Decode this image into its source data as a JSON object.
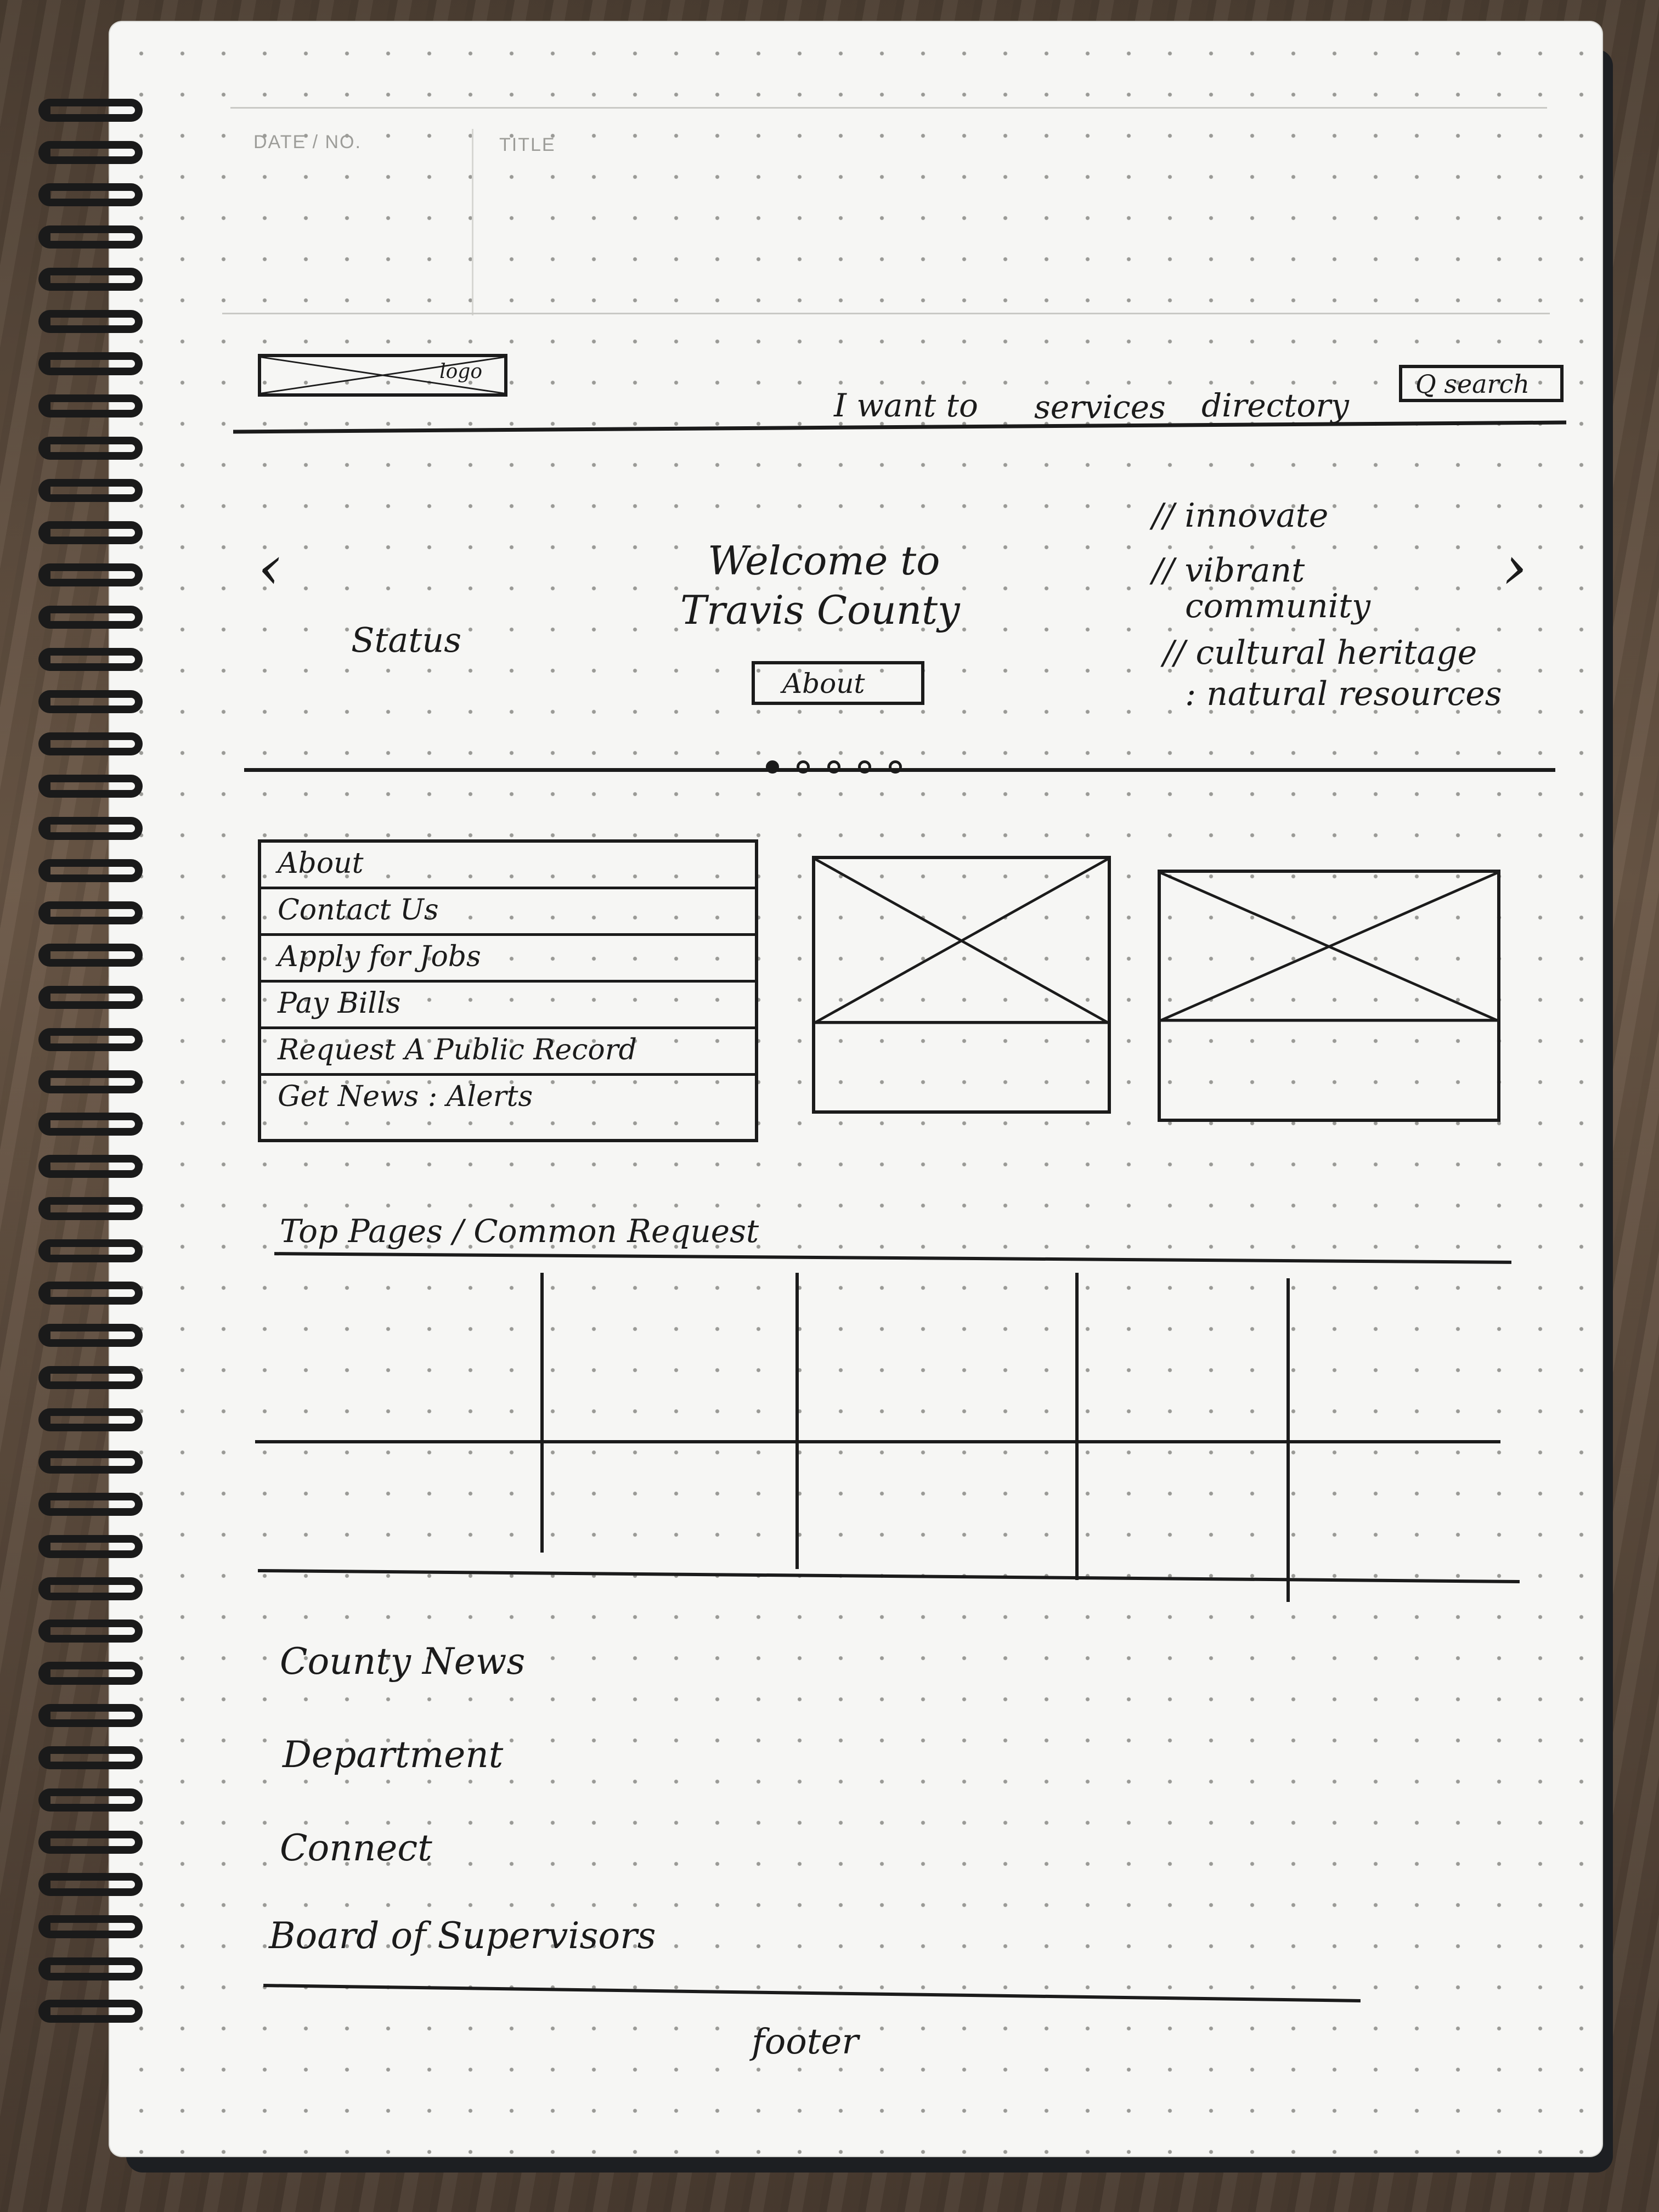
{
  "header_form": {
    "date_label": "DATE / NO.",
    "title_label": "TITLE"
  },
  "nav": {
    "logo": "logo",
    "items": [
      "I want to",
      "services",
      "directory"
    ],
    "search": "Q search"
  },
  "hero": {
    "prev": "‹",
    "next": "›",
    "status": "Status",
    "welcome_line1": "Welcome to",
    "welcome_line2": "Travis County",
    "about_button": "About",
    "taglines": [
      "// innovate",
      "// vibrant",
      "community",
      "// cultural heritage",
      ": natural resources"
    ],
    "carousel_active_index": 0,
    "carousel_count": 5
  },
  "quick_links": [
    "About",
    "Contact Us",
    "Apply for Jobs",
    "Pay Bills",
    "Request A Public Record",
    "Get News : Alerts"
  ],
  "top_pages": {
    "heading": "Top Pages / Common Request"
  },
  "sections": [
    "County News",
    "Department",
    "Connect",
    "Board of Supervisors"
  ],
  "footer": {
    "label": "footer"
  }
}
